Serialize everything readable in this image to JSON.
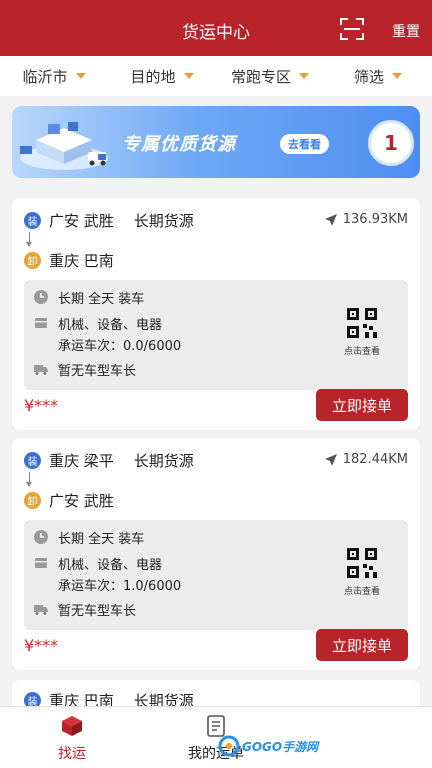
{
  "header": {
    "title": "货运中心",
    "reset_label": "重置"
  },
  "filters": [
    {
      "label": "临沂市"
    },
    {
      "label": "目的地"
    },
    {
      "label": "常跑专区"
    },
    {
      "label": "筛选"
    }
  ],
  "banner": {
    "text": "专属优质货源",
    "button_label": "去看看",
    "count": "1"
  },
  "tags": {
    "load": "装",
    "unload": "卸"
  },
  "cards": [
    {
      "origin": "广安 武胜",
      "source_type": "长期货源",
      "distance": "136.93KM",
      "destination": "重庆 巴南",
      "schedule": "长期  全天 装车",
      "goods": "机械、设备、电器",
      "trips": "承运车次：0.0/6000",
      "vehicle": "暂无车型车长",
      "qr_label": "点击查看",
      "price": "¥***",
      "accept_label": "立即接单"
    },
    {
      "origin": "重庆 梁平",
      "source_type": "长期货源",
      "distance": "182.44KM",
      "destination": "广安 武胜",
      "schedule": "长期  全天 装车",
      "goods": "机械、设备、电器",
      "trips": "承运车次：1.0/6000",
      "vehicle": "暂无车型车长",
      "qr_label": "点击查看",
      "price": "¥***",
      "accept_label": "立即接单"
    },
    {
      "origin": "重庆 巴南",
      "source_type": "长期货源"
    }
  ],
  "tabbar": [
    {
      "label": "找运",
      "active_color": "#b8242a"
    },
    {
      "label": "我的运单"
    }
  ],
  "watermark": {
    "text": "GOGO手游网"
  },
  "colors": {
    "brand": "#b8242a",
    "load_tag": "#3b6fd8",
    "unload_tag": "#e8a03a",
    "banner": "#4d8ef0"
  }
}
